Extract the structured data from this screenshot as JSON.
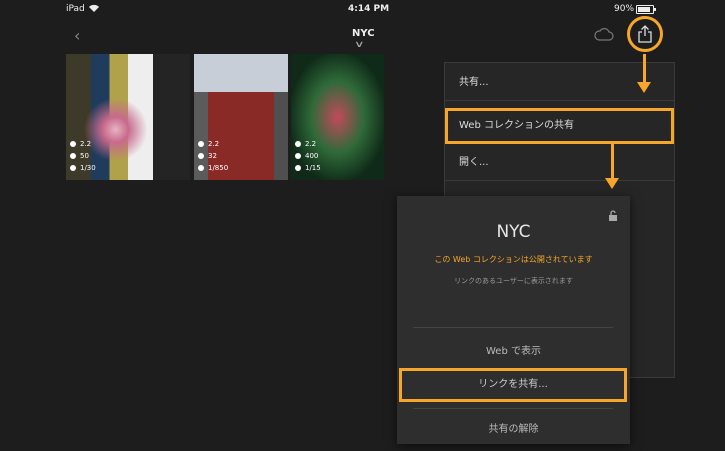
{
  "status_bar": {
    "device": "iPad",
    "time": "4:14 PM",
    "battery": "90%"
  },
  "header": {
    "collection_title": "NYC"
  },
  "photos": [
    {
      "aperture": "2.2",
      "iso": "50",
      "shutter": "1/30"
    },
    {
      "aperture": "2.2",
      "iso": "32",
      "shutter": "1/850"
    },
    {
      "aperture": "2.2",
      "iso": "400",
      "shutter": "1/15"
    }
  ],
  "menu": {
    "items": [
      "共有...",
      "Web コレクションの共有",
      "開く..."
    ],
    "highlighted_index": 1
  },
  "popup": {
    "title": "NYC",
    "status": "この Web コレクションは公開されています",
    "info": "リンクのあるユーザーに表示されます",
    "view_web": "Web で表示",
    "share_link": "リンクを共有...",
    "unshare": "共有の解除"
  },
  "colors": {
    "accent": "#f6a629",
    "background": "#1d1d1d"
  }
}
